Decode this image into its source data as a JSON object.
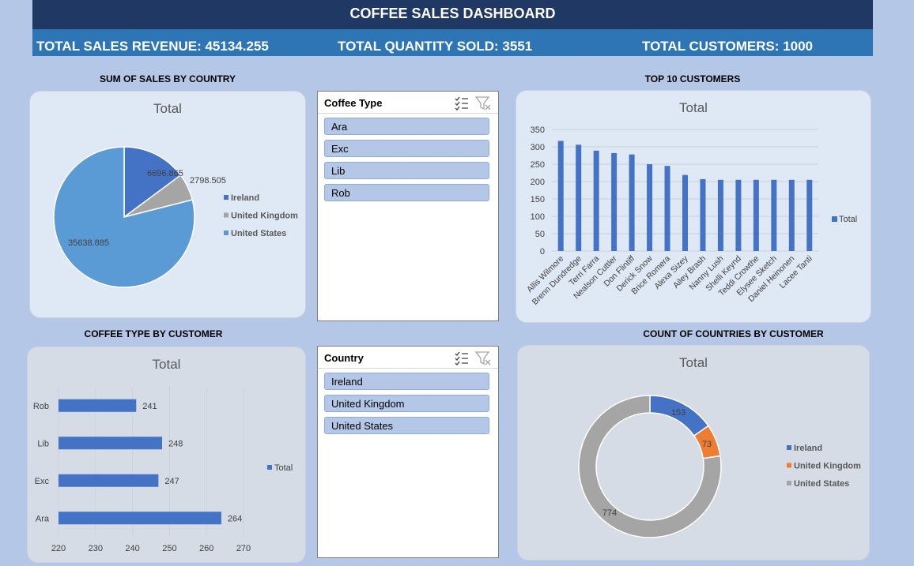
{
  "header": {
    "title": "COFFEE SALES DASHBOARD",
    "revenue_label": "TOTAL SALES REVENUE:  45134.255",
    "quantity_label": "TOTAL QUANTITY SOLD: 3551",
    "customers_label": "TOTAL CUSTOMERS: 1000"
  },
  "sections": {
    "sales_by_country": "SUM OF SALES BY COUNTRY",
    "top_customers": "TOP 10 CUSTOMERS",
    "coffee_by_customer": "COFFEE TYPE BY CUSTOMER",
    "countries_by_customer": "COUNT OF COUNTRIES BY CUSTOMER"
  },
  "slicers": {
    "coffee_type": {
      "header": "Coffee Type",
      "items": [
        "Ara",
        "Exc",
        "Lib",
        "Rob"
      ]
    },
    "country": {
      "header": "Country",
      "items": [
        "Ireland",
        "United Kingdom",
        "United States"
      ]
    }
  },
  "colors": {
    "blue": "#4472c4",
    "grey": "#a5a5a5",
    "lightblue": "#5b9bd5",
    "orange": "#ed7d31"
  },
  "chart_data": [
    {
      "id": "sales_pie",
      "type": "pie",
      "title": "Total",
      "categories": [
        "Ireland",
        "United Kingdom",
        "United States"
      ],
      "values": [
        6696.865,
        2798.505,
        35638.885
      ],
      "colors": [
        "#4472c4",
        "#a5a5a5",
        "#5b9bd5"
      ],
      "legend": "right"
    },
    {
      "id": "top_customers",
      "type": "bar",
      "title": "Total",
      "categories": [
        "Allis Wilmore",
        "Brenn Dundredge",
        "Terri Farra",
        "Nealson Cuttler",
        "Don Flintiff",
        "Derick Snow",
        "Brice Romera",
        "Alexa Sizey",
        "Ailey Brash",
        "Nanny Lush",
        "Shelli Keynd",
        "Teddi Crowthe",
        "Elysee Sketch",
        "Daniel Heinonen",
        "Lacee Tanti"
      ],
      "values": [
        317,
        306,
        289,
        282,
        278,
        250,
        245,
        219,
        207,
        205,
        205,
        205,
        205,
        205,
        205
      ],
      "ylim": [
        0,
        350
      ],
      "yticks": [
        0,
        50,
        100,
        150,
        200,
        250,
        300,
        350
      ],
      "legend_entry": "Total",
      "grid": true
    },
    {
      "id": "coffee_type",
      "type": "bar",
      "orientation": "horizontal",
      "title": "Total",
      "categories": [
        "Ara",
        "Exc",
        "Lib",
        "Rob"
      ],
      "values": [
        264,
        247,
        248,
        241
      ],
      "xlim": [
        220,
        270
      ],
      "xticks": [
        220,
        230,
        240,
        250,
        260,
        270
      ],
      "legend_entry": "Total"
    },
    {
      "id": "country_donut",
      "type": "pie",
      "subtype": "donut",
      "title": "Total",
      "categories": [
        "Ireland",
        "United Kingdom",
        "United States"
      ],
      "values": [
        153,
        73,
        774
      ],
      "colors": [
        "#4472c4",
        "#ed7d31",
        "#a5a5a5"
      ],
      "legend": "right"
    }
  ]
}
